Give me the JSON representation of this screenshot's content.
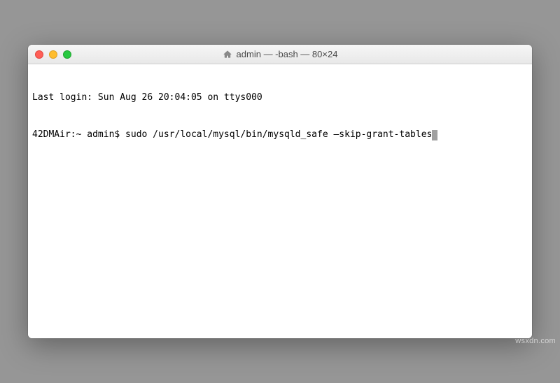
{
  "window": {
    "title": "admin — -bash — 80×24",
    "icon": "home-icon"
  },
  "terminal": {
    "lines": [
      "Last login: Sun Aug 26 20:04:05 on ttys000",
      "42DMAir:~ admin$ sudo /usr/local/mysql/bin/mysqld_safe —skip-grant-tables"
    ]
  },
  "watermark": "wsxdn.com"
}
